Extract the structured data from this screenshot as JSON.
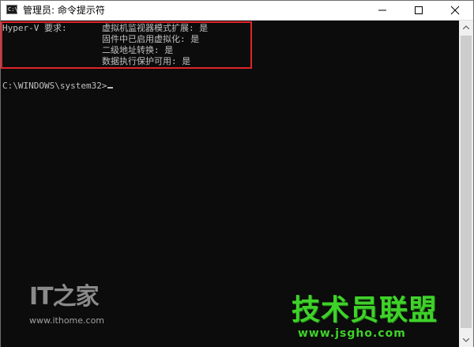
{
  "window": {
    "title": "管理员: 命令提示符"
  },
  "console": {
    "label": "Hyper-V 要求:",
    "requirements": [
      "虚拟机监视器模式扩展: 是",
      "固件中已启用虚拟化: 是",
      "二级地址转换: 是",
      "数据执行保护可用: 是"
    ],
    "prompt": "C:\\WINDOWS\\system32>"
  },
  "watermarks": {
    "ithome_logo": "IT之家",
    "ithome_url": "www.ithome.com",
    "jsgho_brand": "技术员联盟",
    "jsgho_url": "www.jsgho.com"
  },
  "colors": {
    "console_bg": "#0c0c0c",
    "console_text": "#c0c0c0",
    "highlight": "#e0242a",
    "jsgho_green": "#3fd22a"
  },
  "icons": {
    "app": "cmd-icon",
    "minimize": "minimize-icon",
    "maximize": "maximize-icon",
    "close": "close-icon",
    "scroll_up": "chevron-up-icon",
    "scroll_down": "chevron-down-icon"
  }
}
